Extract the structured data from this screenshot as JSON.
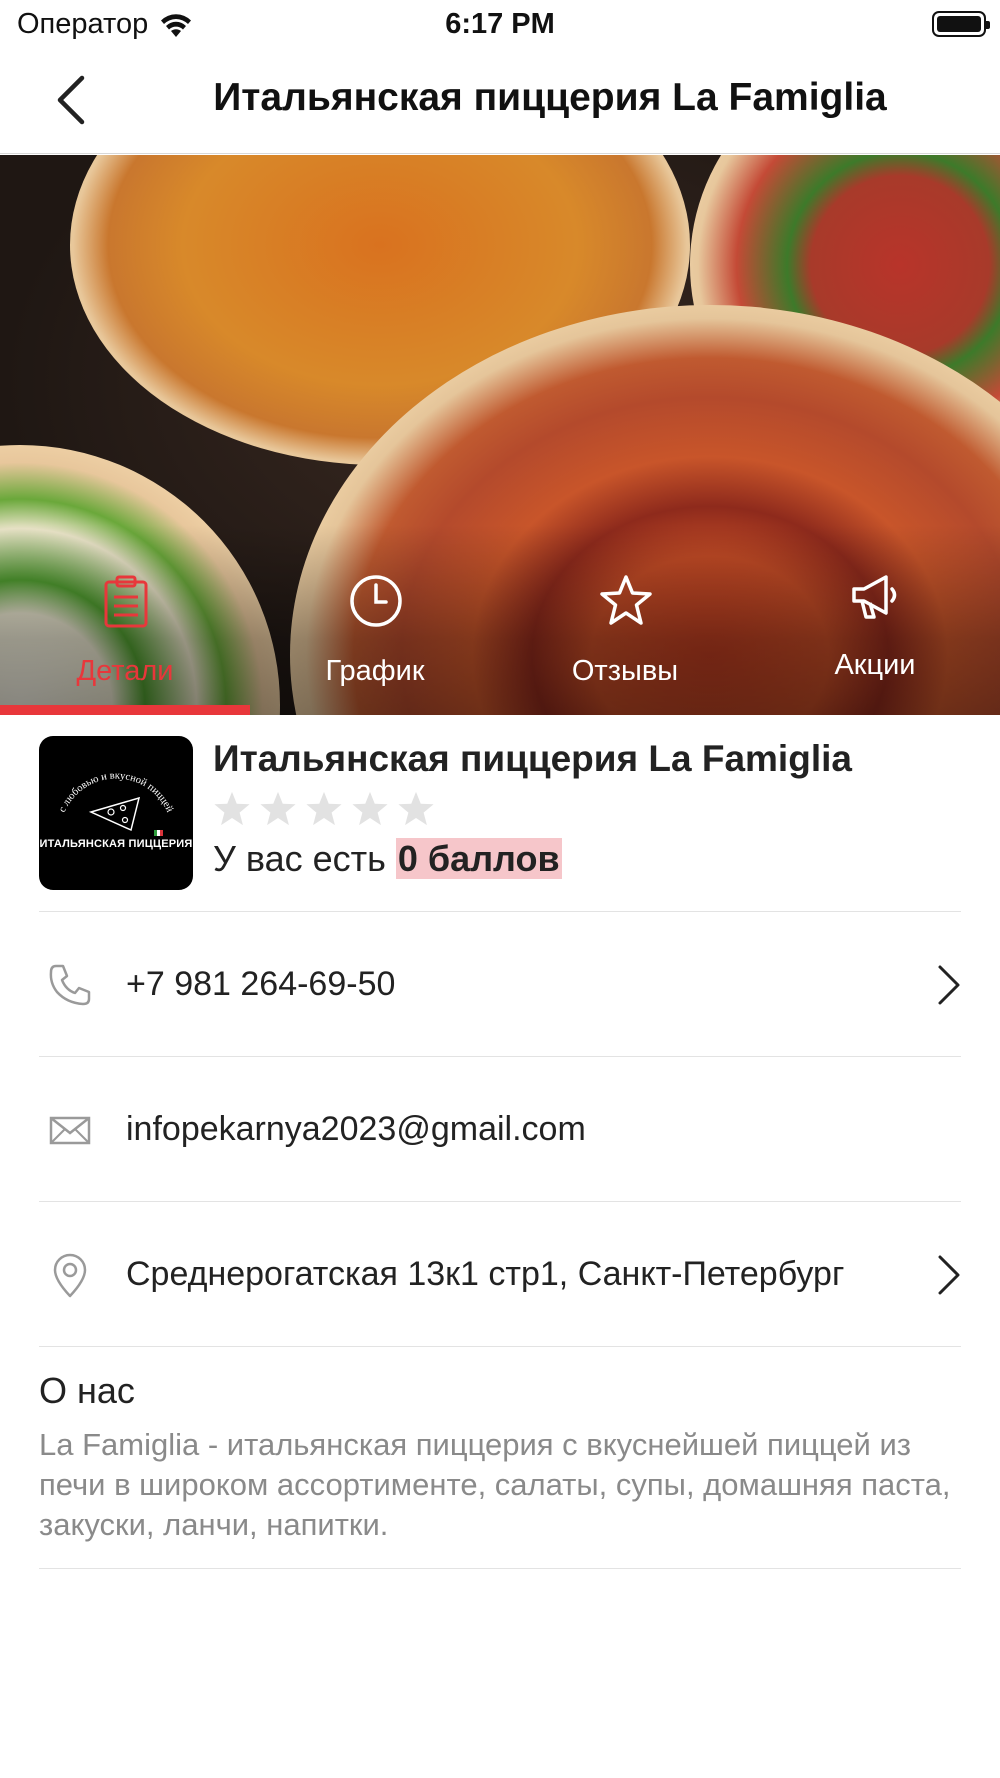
{
  "status_bar": {
    "carrier": "Оператор",
    "time": "6:17 PM"
  },
  "nav": {
    "title": "Итальянская пиццерия La Famiglia"
  },
  "tabs": [
    {
      "label": "Детали",
      "icon": "clipboard-icon",
      "active": true
    },
    {
      "label": "График",
      "icon": "clock-icon",
      "active": false
    },
    {
      "label": "Отзывы",
      "icon": "star-icon",
      "active": false
    },
    {
      "label": "Акции",
      "icon": "megaphone-icon",
      "active": false
    }
  ],
  "business": {
    "name": "Итальянская пиццерия La Famiglia",
    "logo_text": "ИТАЛЬЯНСКАЯ ПИЦЦЕРИЯ",
    "logo_arc_text": "с любовью и вкусной пиццей",
    "rating": 0,
    "rating_max": 5,
    "points_prefix": "У вас есть",
    "points_value": "0 баллов"
  },
  "contacts": {
    "phone": "+7 981 264-69-50",
    "email": "infopekarnya2023@gmail.com",
    "address": "Среднерогатская 13к1 стр1, Санкт-Петербург"
  },
  "about": {
    "title": "О нас",
    "text": "La Famiglia - итальянская пиццерия с вкуснейшей пиццей из печи в широком ассортименте, салаты, супы, домашняя паста, закуски, ланчи, напитки."
  },
  "colors": {
    "accent": "#e8373b",
    "highlight": "#f6c6ca",
    "muted_text": "#8a8a8a"
  }
}
